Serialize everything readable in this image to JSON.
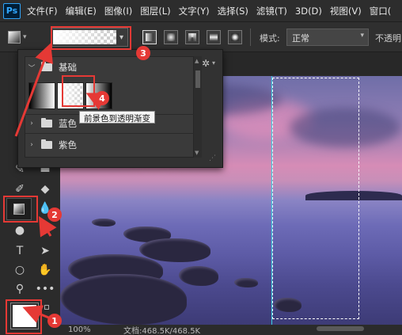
{
  "menubar": {
    "logo": "Ps",
    "items": [
      "文件(F)",
      "编辑(E)",
      "图像(I)",
      "图层(L)",
      "文字(Y)",
      "选择(S)",
      "滤镜(T)",
      "3D(D)",
      "视图(V)",
      "窗口("
    ]
  },
  "options": {
    "mode_label": "模式:",
    "mode_value": "正常",
    "opacity_label": "不透明"
  },
  "gradient_panel": {
    "folders": [
      {
        "label": "基础",
        "expanded": true
      },
      {
        "label": "蓝色",
        "expanded": false
      },
      {
        "label": "紫色",
        "expanded": false
      }
    ],
    "tooltip": "前景色到透明渐变"
  },
  "status": {
    "zoom": "100%",
    "doc": "文档:468.5K/468.5K"
  },
  "annotations": {
    "badges": [
      "1",
      "2",
      "3",
      "4"
    ],
    "color": "#e53935"
  },
  "colors": {
    "accent_guide": "#39d0e0",
    "foreground": "#ffffff"
  }
}
